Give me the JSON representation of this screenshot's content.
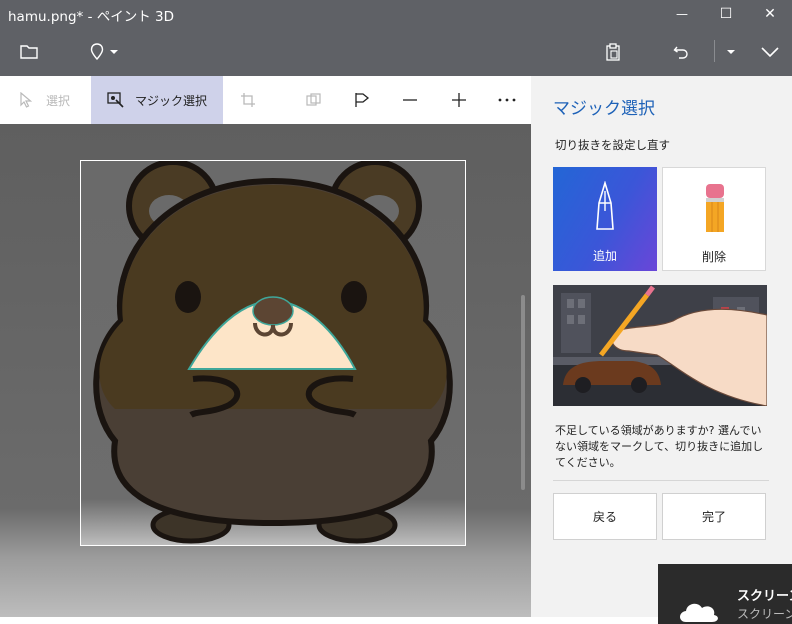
{
  "window": {
    "title": "hamu.png* - ペイント 3D",
    "minimize_glyph": "—",
    "maximize_glyph": "☐",
    "close_glyph": "✕"
  },
  "commandbar": {
    "icons": [
      "folder-icon",
      "location-pin-icon",
      "chevron-down-icon",
      "paste-icon",
      "undo-icon",
      "dropdown-icon",
      "expand-icon"
    ]
  },
  "toolbar": {
    "select_label": "選択",
    "magic_select_label": "マジック選択"
  },
  "panel": {
    "title": "マジック選択",
    "subtitle": "切り抜きを設定し直す",
    "add_label": "追加",
    "remove_label": "削除",
    "help_text": "不足している領域がありますか? 選んでいない領域をマークして、切り抜きに追加してください。",
    "back_label": "戻る",
    "done_label": "完了"
  },
  "toast": {
    "title": "スクリーン",
    "subtitle": "スクリーン"
  },
  "colors": {
    "accent": "#1e62b8",
    "titlebar": "#5f6166",
    "active_tool": "#cfd2ea",
    "add_gradient_start": "#2366d6",
    "add_gradient_end": "#6a46d8"
  }
}
